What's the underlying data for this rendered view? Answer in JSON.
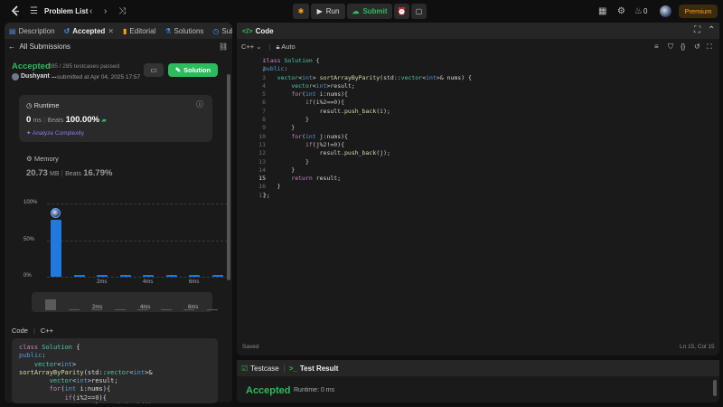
{
  "topbar": {
    "problem_list": "Problem List",
    "run": "Run",
    "submit": "Submit",
    "fire_count": "0",
    "premium": "Premium"
  },
  "left_tabs": [
    {
      "label": "Description",
      "icon": "description-icon"
    },
    {
      "label": "Accepted",
      "icon": "history-icon",
      "active": true
    },
    {
      "label": "Editorial",
      "icon": "book-icon"
    },
    {
      "label": "Solutions",
      "icon": "flask-icon"
    },
    {
      "label": "Subm",
      "icon": "clock-icon"
    }
  ],
  "submission": {
    "back_label": "All Submissions",
    "status": "Accepted",
    "passed": "285 / 285 testcases passed",
    "user": "Dushyant ...",
    "submitted": "submitted at Apr 04, 2025 17:57",
    "solution_button": "Solution"
  },
  "runtime": {
    "title": "Runtime",
    "value": "0",
    "unit": "ms",
    "beats_label": "Beats",
    "beats": "100.00%",
    "analyze": "Analyze Complexity"
  },
  "memory": {
    "title": "Memory",
    "value": "20.73",
    "unit": "MB",
    "beats_label": "Beats",
    "beats": "16.79%"
  },
  "chart_data": {
    "type": "bar",
    "yticks": [
      "100%",
      "50%",
      "0%"
    ],
    "xticks": [
      "2ms",
      "4ms",
      "6ms"
    ],
    "ylim": [
      0,
      100
    ],
    "values": [
      78,
      2,
      2,
      2,
      3,
      2,
      2,
      2
    ],
    "highlight_index": 0,
    "mini_xticks": [
      "2ms",
      "4ms",
      "6ms"
    ]
  },
  "code_section": {
    "label": "Code",
    "lang": "C++"
  },
  "editor": {
    "title": "Code",
    "language": "C++",
    "mode": "Auto",
    "status_left": "Saved",
    "status_right": "Ln 15, Col 15"
  },
  "result": {
    "testcase_tab": "Testcase",
    "result_tab": "Test Result",
    "status": "Accepted",
    "runtime": "Runtime: 0 ms"
  },
  "colors": {
    "accepted": "#2cbb5d",
    "accent": "#ffa116",
    "bar": "#1f7ae0"
  }
}
